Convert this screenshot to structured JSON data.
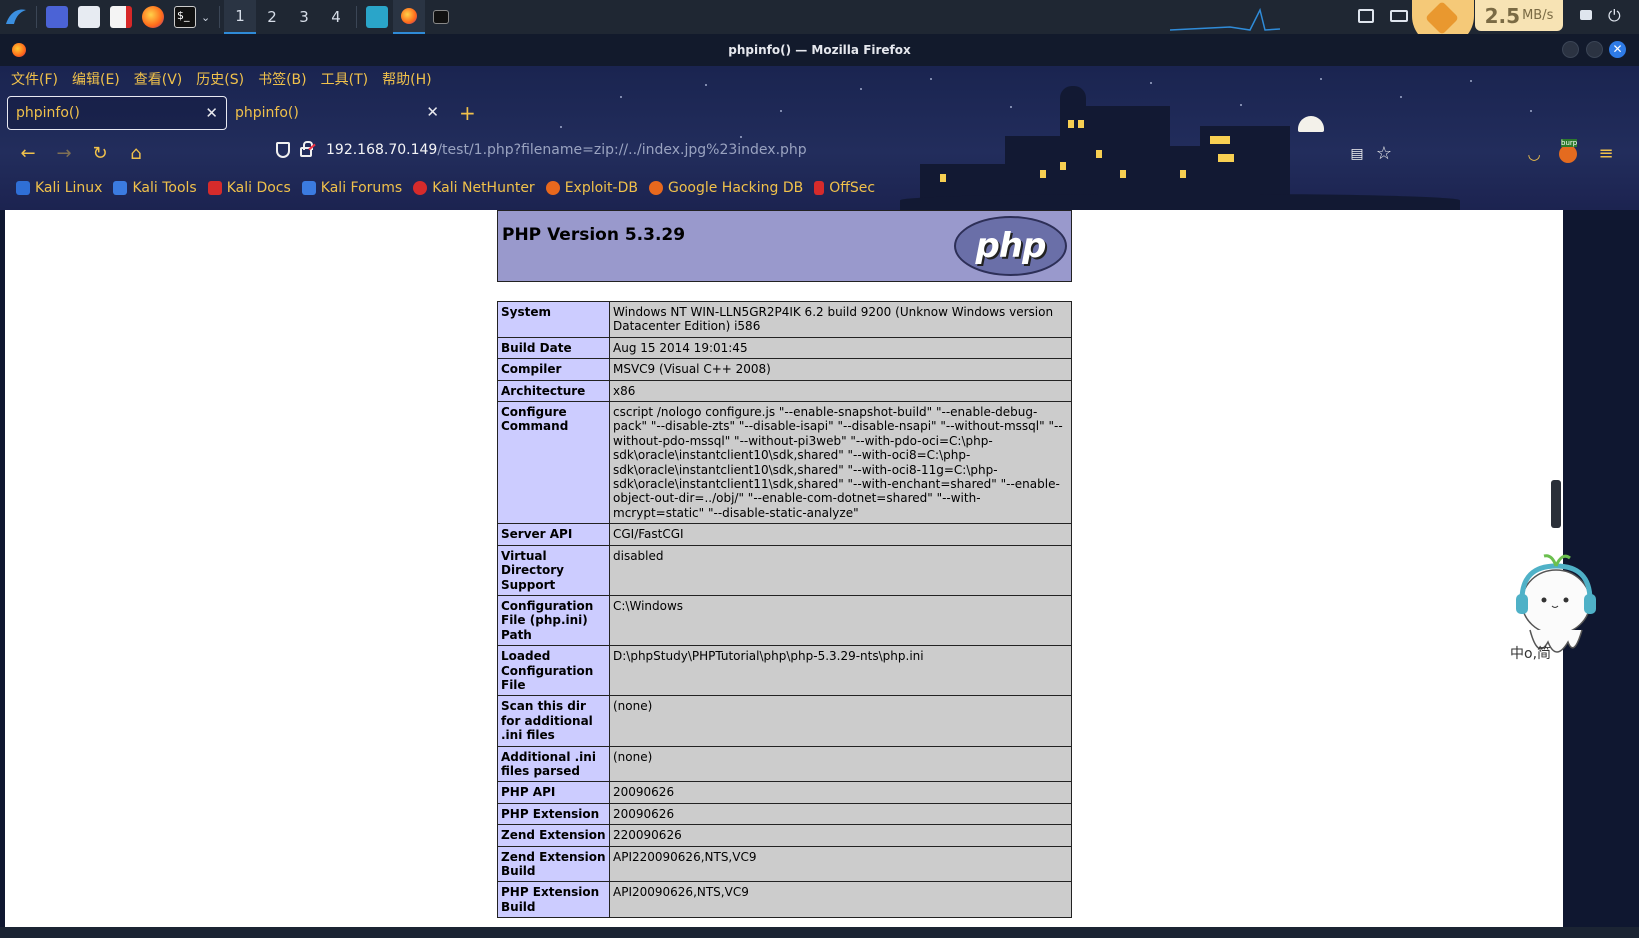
{
  "taskbar": {
    "workspaces": [
      "1",
      "2",
      "3",
      "4"
    ],
    "network_speed": "2.5",
    "network_unit": "MB/s"
  },
  "window": {
    "title": "phpinfo() — Mozilla Firefox"
  },
  "menubar": [
    "文件(F)",
    "编辑(E)",
    "查看(V)",
    "历史(S)",
    "书签(B)",
    "工具(T)",
    "帮助(H)"
  ],
  "tabs": [
    {
      "label": "phpinfo()",
      "selected": true
    },
    {
      "label": "phpinfo()",
      "selected": false
    }
  ],
  "url": {
    "host": "192.168.70.149",
    "path": "/test/1.php?filename=zip://../index.jpg%23index.php"
  },
  "extension": {
    "label": "burp"
  },
  "bookmarks": [
    {
      "label": "Kali Linux",
      "color": "#2f6fd6"
    },
    {
      "label": "Kali Tools",
      "color": "#3b7be0"
    },
    {
      "label": "Kali Docs",
      "color": "#d62b2b"
    },
    {
      "label": "Kali Forums",
      "color": "#3b7be0"
    },
    {
      "label": "Kali NetHunter",
      "color": "#d62b2b"
    },
    {
      "label": "Exploit-DB",
      "color": "#e8681d"
    },
    {
      "label": "Google Hacking DB",
      "color": "#e8681d"
    },
    {
      "label": "OffSec",
      "color": "#d62b2b"
    }
  ],
  "php": {
    "version_title": "PHP Version 5.3.29",
    "logo_text": "php",
    "rows": [
      {
        "k": "System",
        "v": "Windows NT WIN-LLN5GR2P4IK 6.2 build 9200 (Unknow Windows version Datacenter Edition) i586"
      },
      {
        "k": "Build Date",
        "v": "Aug 15 2014 19:01:45"
      },
      {
        "k": "Compiler",
        "v": "MSVC9 (Visual C++ 2008)"
      },
      {
        "k": "Architecture",
        "v": "x86"
      },
      {
        "k": "Configure Command",
        "v": "cscript /nologo configure.js \"--enable-snapshot-build\" \"--enable-debug-pack\" \"--disable-zts\" \"--disable-isapi\" \"--disable-nsapi\" \"--without-mssql\" \"--without-pdo-mssql\" \"--without-pi3web\" \"--with-pdo-oci=C:\\php-sdk\\oracle\\instantclient10\\sdk,shared\" \"--with-oci8=C:\\php-sdk\\oracle\\instantclient10\\sdk,shared\" \"--with-oci8-11g=C:\\php-sdk\\oracle\\instantclient11\\sdk,shared\" \"--with-enchant=shared\" \"--enable-object-out-dir=../obj/\" \"--enable-com-dotnet=shared\" \"--with-mcrypt=static\" \"--disable-static-analyze\""
      },
      {
        "k": "Server API",
        "v": "CGI/FastCGI"
      },
      {
        "k": "Virtual Directory Support",
        "v": "disabled"
      },
      {
        "k": "Configuration File (php.ini) Path",
        "v": "C:\\Windows"
      },
      {
        "k": "Loaded Configuration File",
        "v": "D:\\phpStudy\\PHPTutorial\\php\\php-5.3.29-nts\\php.ini"
      },
      {
        "k": "Scan this dir for additional .ini files",
        "v": "(none)"
      },
      {
        "k": "Additional .ini files parsed",
        "v": "(none)"
      },
      {
        "k": "PHP API",
        "v": "20090626"
      },
      {
        "k": "PHP Extension",
        "v": "20090626"
      },
      {
        "k": "Zend Extension",
        "v": "220090626"
      },
      {
        "k": "Zend Extension Build",
        "v": "API220090626,NTS,VC9"
      },
      {
        "k": "PHP Extension Build",
        "v": "API20090626,NTS,VC9"
      }
    ]
  },
  "mascot": {
    "caption": "中o,简"
  }
}
